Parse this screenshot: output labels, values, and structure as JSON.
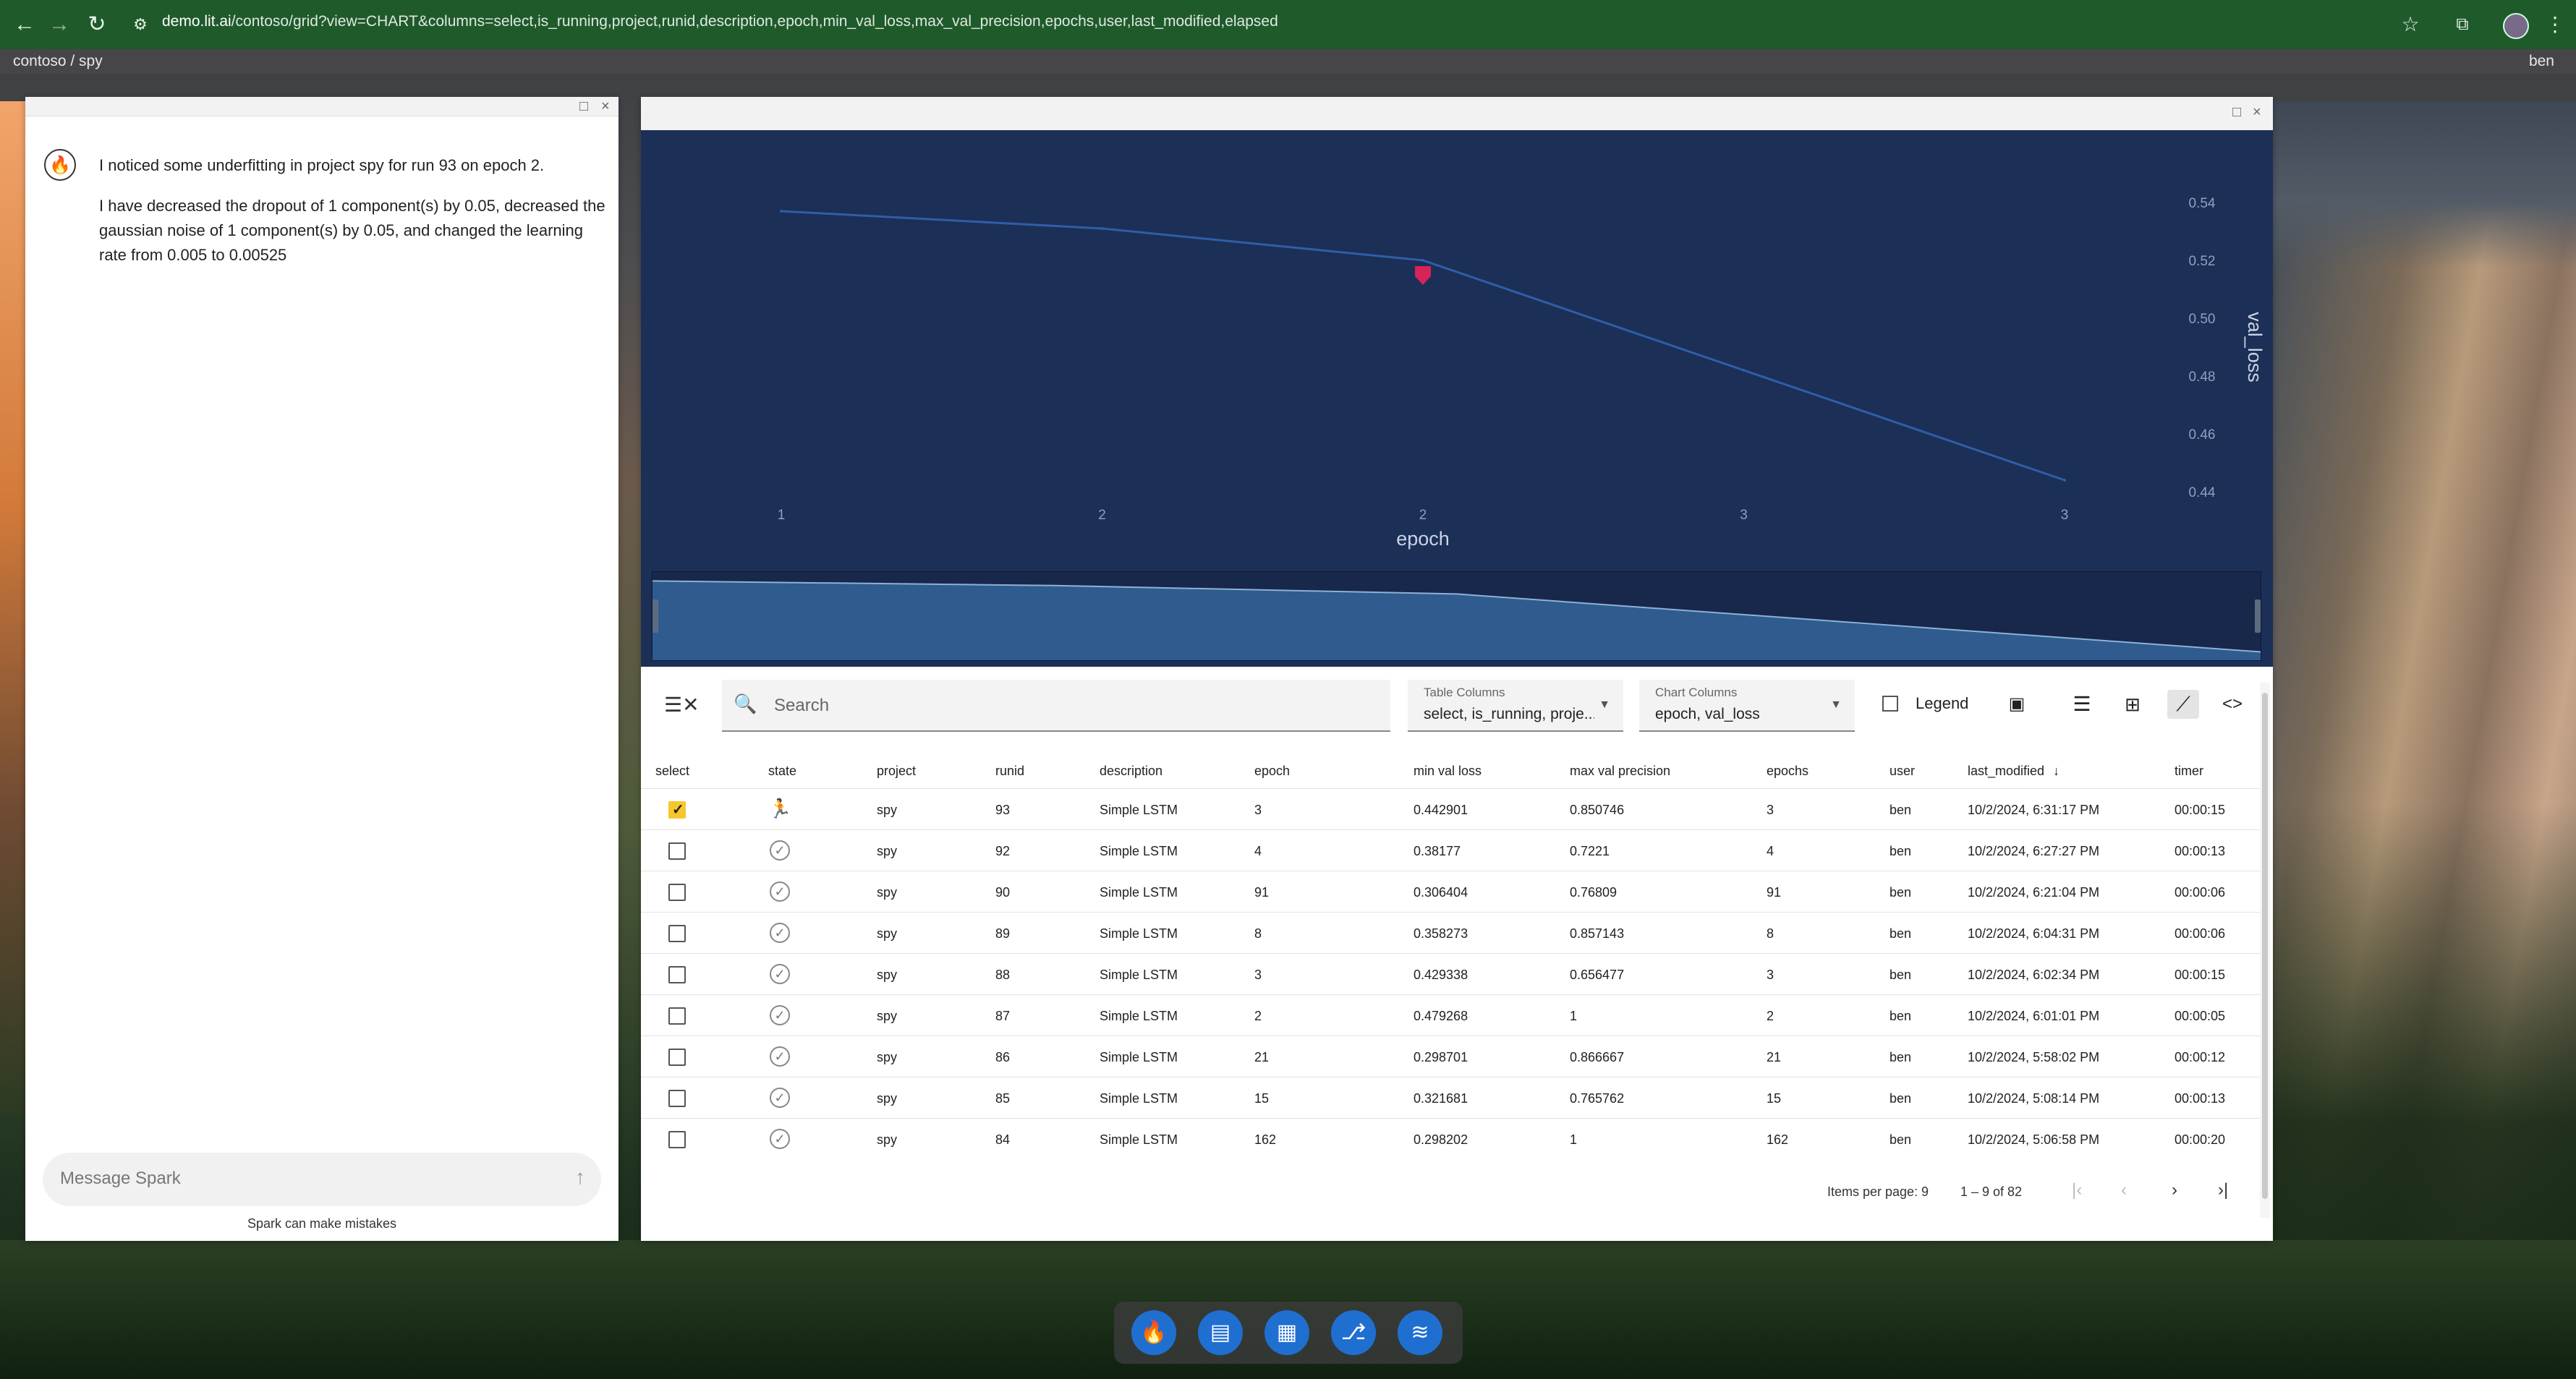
{
  "browser": {
    "url_host": "demo.lit.ai",
    "url_path": "/contoso/grid?view=CHART&columns=select,is_running,project,runid,description,epoch,min_val_loss,max_val_precision,epochs,user,last_modified,elapsed"
  },
  "app": {
    "breadcrumb": "contoso / spy",
    "user": "ben"
  },
  "chat": {
    "messages": [
      "I noticed some underfitting in project spy for run 93 on epoch 2.",
      "I have decreased the dropout of 1 component(s) by 0.05, decreased the gaussian noise of 1 component(s) by 0.05, and changed the learning rate from 0.005 to 0.00525"
    ],
    "input_placeholder": "Message Spark",
    "disclaimer": "Spark can make mistakes"
  },
  "chart_data": {
    "type": "line",
    "xlabel": "epoch",
    "ylabel": "val_loss",
    "x_ticks": [
      "1",
      "2",
      "2",
      "3",
      "3"
    ],
    "y_ticks": [
      "0.54",
      "0.52",
      "0.50",
      "0.48",
      "0.46",
      "0.44"
    ],
    "ylim": [
      0.435,
      0.545
    ],
    "series": [
      {
        "values": [
          0.537,
          0.531,
          0.52,
          0.482,
          0.444
        ]
      }
    ],
    "marker_index": 2,
    "grid": false
  },
  "toolbar": {
    "search_placeholder": "Search",
    "table_columns_label": "Table Columns",
    "table_columns_value": "select, is_running, proje...",
    "chart_columns_label": "Chart Columns",
    "chart_columns_value": "epoch, val_loss",
    "legend_label": "Legend",
    "legend_checked": false
  },
  "table": {
    "headers": [
      "select",
      "state",
      "project",
      "runid",
      "description",
      "epoch",
      "min val loss",
      "max val precision",
      "epochs",
      "user",
      "last_modified",
      "timer"
    ],
    "rows": [
      {
        "selected": true,
        "state": "running",
        "project": "spy",
        "runid": "93",
        "description": "Simple LSTM",
        "epoch": "3",
        "min_val_loss": "0.442901",
        "max_val_precision": "0.850746",
        "epochs": "3",
        "user": "ben",
        "last_modified": "10/2/2024, 6:31:17 PM",
        "timer": "00:00:15"
      },
      {
        "selected": false,
        "state": "complete",
        "project": "spy",
        "runid": "92",
        "description": "Simple LSTM",
        "epoch": "4",
        "min_val_loss": "0.38177",
        "max_val_precision": "0.7221",
        "epochs": "4",
        "user": "ben",
        "last_modified": "10/2/2024, 6:27:27 PM",
        "timer": "00:00:13"
      },
      {
        "selected": false,
        "state": "complete",
        "project": "spy",
        "runid": "90",
        "description": "Simple LSTM",
        "epoch": "91",
        "min_val_loss": "0.306404",
        "max_val_precision": "0.76809",
        "epochs": "91",
        "user": "ben",
        "last_modified": "10/2/2024, 6:21:04 PM",
        "timer": "00:00:06"
      },
      {
        "selected": false,
        "state": "complete",
        "project": "spy",
        "runid": "89",
        "description": "Simple LSTM",
        "epoch": "8",
        "min_val_loss": "0.358273",
        "max_val_precision": "0.857143",
        "epochs": "8",
        "user": "ben",
        "last_modified": "10/2/2024, 6:04:31 PM",
        "timer": "00:00:06"
      },
      {
        "selected": false,
        "state": "complete",
        "project": "spy",
        "runid": "88",
        "description": "Simple LSTM",
        "epoch": "3",
        "min_val_loss": "0.429338",
        "max_val_precision": "0.656477",
        "epochs": "3",
        "user": "ben",
        "last_modified": "10/2/2024, 6:02:34 PM",
        "timer": "00:00:15"
      },
      {
        "selected": false,
        "state": "complete",
        "project": "spy",
        "runid": "87",
        "description": "Simple LSTM",
        "epoch": "2",
        "min_val_loss": "0.479268",
        "max_val_precision": "1",
        "epochs": "2",
        "user": "ben",
        "last_modified": "10/2/2024, 6:01:01 PM",
        "timer": "00:00:05"
      },
      {
        "selected": false,
        "state": "complete",
        "project": "spy",
        "runid": "86",
        "description": "Simple LSTM",
        "epoch": "21",
        "min_val_loss": "0.298701",
        "max_val_precision": "0.866667",
        "epochs": "21",
        "user": "ben",
        "last_modified": "10/2/2024, 5:58:02 PM",
        "timer": "00:00:12"
      },
      {
        "selected": false,
        "state": "complete",
        "project": "spy",
        "runid": "85",
        "description": "Simple LSTM",
        "epoch": "15",
        "min_val_loss": "0.321681",
        "max_val_precision": "0.765762",
        "epochs": "15",
        "user": "ben",
        "last_modified": "10/2/2024, 5:08:14 PM",
        "timer": "00:00:13"
      },
      {
        "selected": false,
        "state": "complete",
        "project": "spy",
        "runid": "84",
        "description": "Simple LSTM",
        "epoch": "162",
        "min_val_loss": "0.298202",
        "max_val_precision": "1",
        "epochs": "162",
        "user": "ben",
        "last_modified": "10/2/2024, 5:06:58 PM",
        "timer": "00:00:20"
      }
    ]
  },
  "paginator": {
    "items_per_page_label": "Items per page:",
    "items_per_page": "9",
    "range": "1 – 9 of 82"
  },
  "colors": {
    "chart_bg": "#1c2f56",
    "line": "#2f5ea8",
    "marker": "#d6245a",
    "running": "#3cb54a",
    "selected": "#f7c62f",
    "dock_button": "#1f6fd1"
  },
  "dock": {
    "icons": [
      "flame-icon",
      "grid-report-icon",
      "dashboard-icon",
      "tree-icon",
      "wind-icon"
    ]
  }
}
